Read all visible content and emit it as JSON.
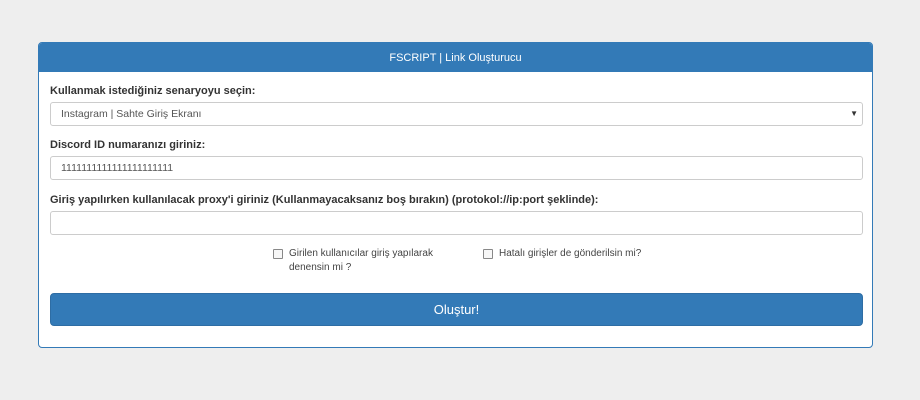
{
  "panel": {
    "title": "FSCRIPT | Link Oluşturucu"
  },
  "scenario": {
    "label": "Kullanmak istediğiniz senaryoyu seçin:",
    "selected": "Instagram | Sahte Giriş Ekranı"
  },
  "discord": {
    "label": "Discord ID numaranızı giriniz:",
    "value": "1111111111111111111111"
  },
  "proxy": {
    "label": "Giriş yapılırken kullanılacak proxy'i giriniz (Kullanmayacaksanız boş bırakın) (protokol://ip:port şeklinde):",
    "value": ""
  },
  "options": {
    "try_login_line1": "Girilen kullanıcılar giriş yapılarak",
    "try_login_line2": "denensin mi ?",
    "try_login_checked": false,
    "send_failed": "Hatalı girişler de gönderilsin mi?",
    "send_failed_checked": false
  },
  "submit": {
    "label": "Oluştur!"
  },
  "colors": {
    "primary": "#337ab7",
    "background": "#eeeeee"
  },
  "icons": {
    "select_caret": "chevron-down-icon"
  }
}
